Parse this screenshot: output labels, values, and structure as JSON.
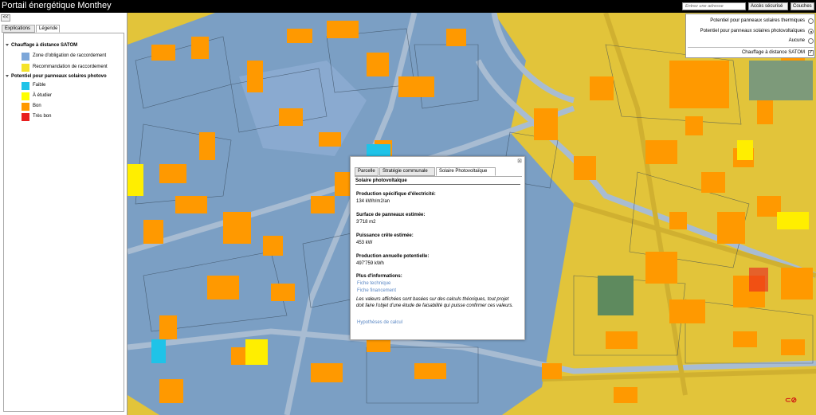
{
  "app": {
    "title": "Portail énergétique Monthey"
  },
  "topbar": {
    "address_placeholder": "Entrez une adresse",
    "secure_access": "Accès sécurisé",
    "layers": "Couches"
  },
  "left_panel": {
    "collapse": "<<",
    "tabs": [
      "Explications",
      "Légende"
    ],
    "legend": {
      "group1": {
        "title": "Chauffage à distance SATOM",
        "items": [
          {
            "label": "Zone d'obligation de raccordement",
            "color": "#7da7d9"
          },
          {
            "label": "Recommandation de raccordement",
            "color": "#f5e32a"
          }
        ]
      },
      "group2": {
        "title": "Potentiel pour panneaux solaires photovo",
        "items": [
          {
            "label": "Faible",
            "color": "#1fc3e8"
          },
          {
            "label": "À étudier",
            "color": "#ffff00"
          },
          {
            "label": "Bon",
            "color": "#ff9900"
          },
          {
            "label": "Très bon",
            "color": "#e81f1f"
          }
        ]
      }
    }
  },
  "layers_panel": {
    "options": [
      {
        "label": "Potentiel pour panneaux solaires thermiques",
        "selected": false
      },
      {
        "label": "Potentiel pour panneaux solaires photovoltaïques",
        "selected": true
      },
      {
        "label": "Aucune",
        "selected": false
      }
    ],
    "overlay": {
      "label": "Chauffage à distance SATOM",
      "checked": true,
      "mark": "✓"
    }
  },
  "popup": {
    "close": "⊠",
    "tabs": [
      "Parcelle",
      "Stratégie communale",
      "Solaire Photovoltaïque"
    ],
    "header": "Solaire photovoltaïque",
    "fields": [
      {
        "label": "Production spécifique d'électricité:",
        "value": "134 kWh/m2/an"
      },
      {
        "label": "Surface de panneaux estimée:",
        "value": "3'718 m2"
      },
      {
        "label": "Puissance crête estimée:",
        "value": "453 kW"
      },
      {
        "label": "Production annuelle potentielle:",
        "value": "497'759 kWh"
      }
    ],
    "more_info_label": "Plus d'informations:",
    "links": [
      "Fiche technique",
      "Fiche financement"
    ],
    "note": "Les valeurs affichées sont basées sur des calculs théoriques, tout projet doit faire l'objet d'une étude de faisabilité qui puisse confirmer ces valeurs.",
    "hypotheses_link": "Hypothèses de calcul"
  },
  "map_colors": {
    "zone_yellow": "#e2c43a",
    "zone_blue": "#7b9fc4",
    "roof_orange": "#ff9900",
    "road": "#9db4cc"
  }
}
